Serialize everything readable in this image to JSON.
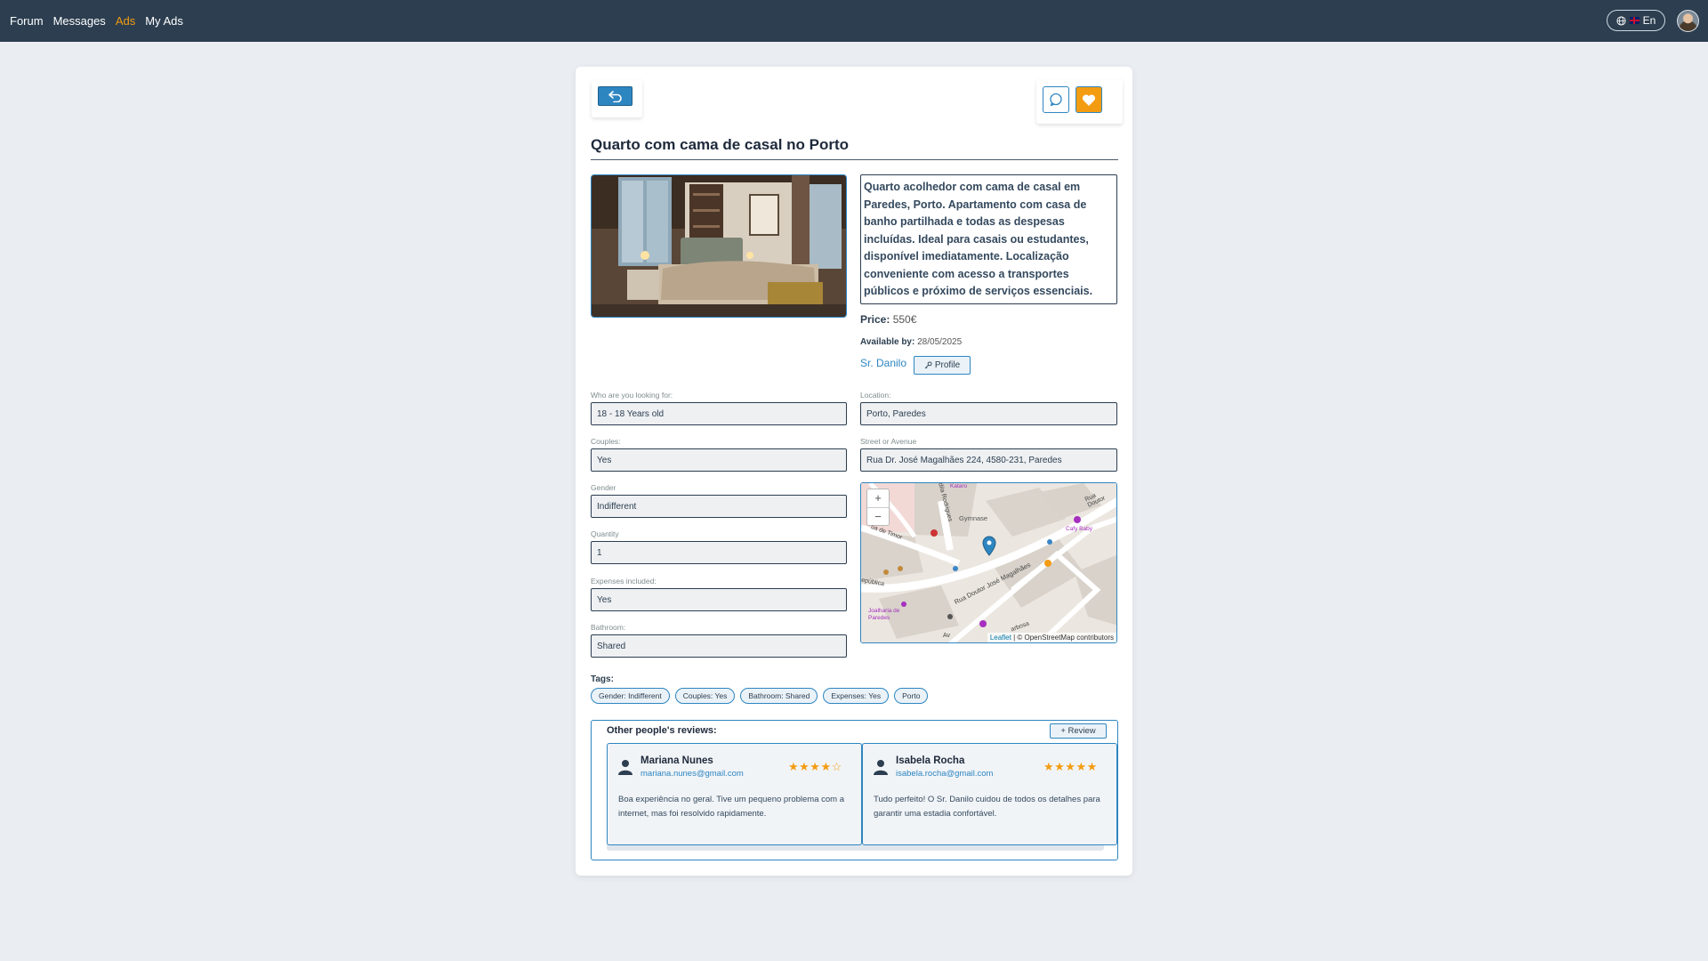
{
  "nav": {
    "items": [
      {
        "label": "Forum"
      },
      {
        "label": "Messages"
      },
      {
        "label": "Ads"
      },
      {
        "label": "My Ads"
      }
    ],
    "active": "Ads",
    "lang_label": "En",
    "lang_icon": "globe-icon",
    "avatar_icon": "user-avatar"
  },
  "ad": {
    "title": "Quarto com cama de casal no Porto",
    "description": "Quarto acolhedor com cama de casal em Paredes, Porto. Apartamento com casa de banho partilhada e todas as despesas incluídas. Ideal para casais ou estudantes, disponível imediatamente. Localização conveniente com acesso a transportes públicos e próximo de serviços essenciais.",
    "price_label": "Price:",
    "price_value": "550€",
    "available_label": "Available by:",
    "available_value": "28/05/2025",
    "owner_name": "Sr. Danilo",
    "profile_button": "Profile",
    "profile_icon": "key-icon"
  },
  "fields": {
    "looking_for": {
      "label": "Who are you looking for:",
      "value": "18 - 18 Years old"
    },
    "couples": {
      "label": "Couples:",
      "value": "Yes"
    },
    "gender": {
      "label": "Gender",
      "value": "Indifferent"
    },
    "quantity": {
      "label": "Quantity",
      "value": "1"
    },
    "expenses": {
      "label": "Expenses included:",
      "value": "Yes"
    },
    "bathroom": {
      "label": "Bathroom:",
      "value": "Shared"
    },
    "location": {
      "label": "Location:",
      "value": "Porto, Paredes"
    },
    "street": {
      "label": "Street or Avenue",
      "value": "Rua Dr. José Magalhães 224, 4580-231, Paredes"
    }
  },
  "map": {
    "zoom_in": "+",
    "zoom_out": "−",
    "attribution_leaflet": "Leaflet",
    "attribution_rest": "| © OpenStreetMap contributors",
    "labels": {
      "street_main": "Rua Doutor José Magalhães",
      "gymnase": "Gymnase",
      "timor": "ua de Timor",
      "republica": "epública",
      "cafe": "Cafy Baby",
      "rua_doutor": "Rua Doutor",
      "joalharia": "Joalharia de Paredes",
      "kataro": "Kataro",
      "rodrigues": "dila Rodrigues",
      "bosa": "arbosa",
      "av": "Av"
    }
  },
  "tags": {
    "label": "Tags:",
    "items": [
      "Gender: Indifferent",
      "Couples: Yes",
      "Bathroom: Shared",
      "Expenses: Yes",
      "Porto"
    ]
  },
  "reviews": {
    "title": "Other people's reviews:",
    "add_button": "+ Review",
    "items": [
      {
        "name": "Mariana Nunes",
        "email": "mariana.nunes@gmail.com",
        "rating": 4,
        "stars": "★★★★☆",
        "text": "Boa experiência no geral. Tive um pequeno problema com a internet, mas foi resolvido rapidamente."
      },
      {
        "name": "Isabela Rocha",
        "email": "isabela.rocha@gmail.com",
        "rating": 5,
        "stars": "★★★★★",
        "text": "Tudo perfeito! O Sr. Danilo cuidou de todos os detalhes para garantir uma estadia confortável."
      }
    ]
  },
  "colors": {
    "navbar": "#2c3e50",
    "accent": "#f39c12",
    "primary": "#2e86c1",
    "background": "#eaeef2"
  }
}
